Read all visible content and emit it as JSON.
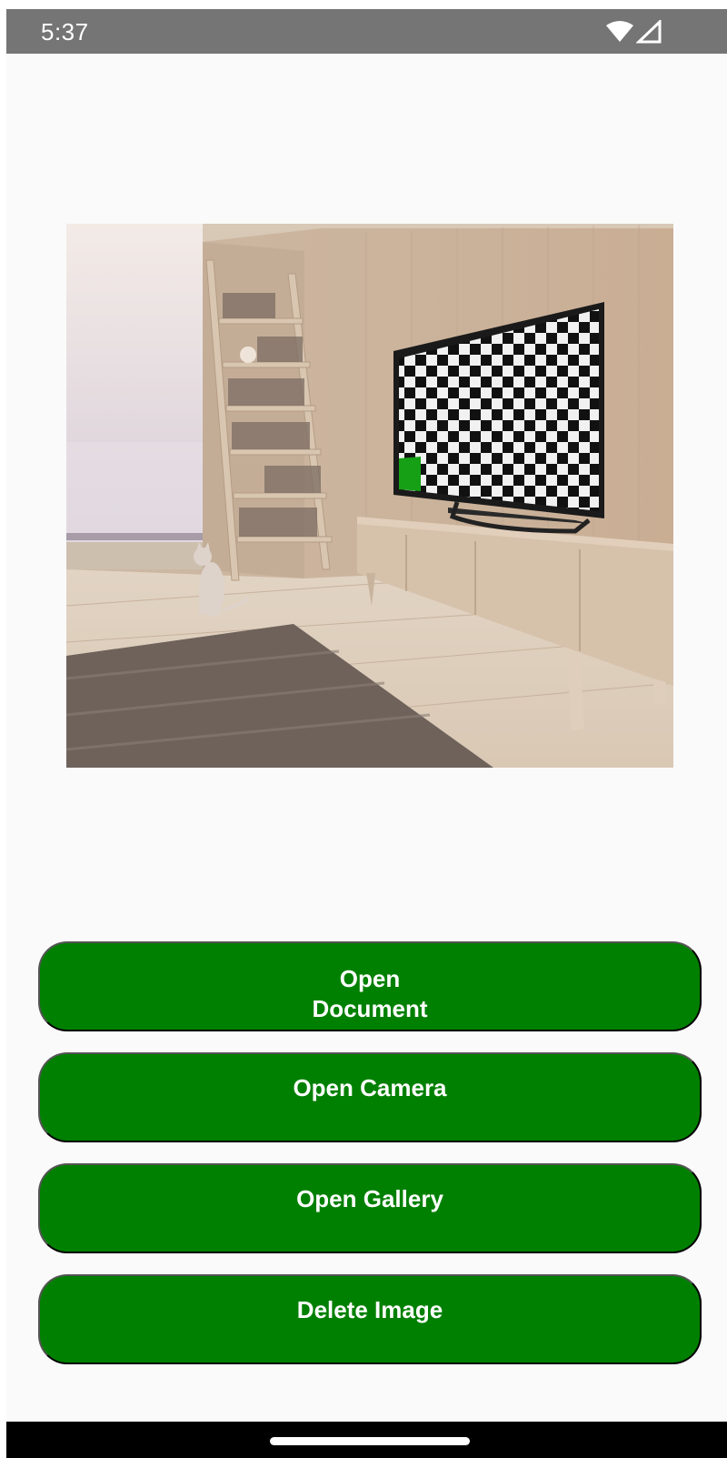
{
  "status_bar": {
    "time": "5:37",
    "icons": [
      "wifi-icon",
      "cell-signal-icon"
    ]
  },
  "preview": {
    "image_name": "room-preview-image",
    "description_icon": "living-room-photo"
  },
  "buttons": {
    "open_document": "Open\nDocument",
    "open_camera": "Open Camera",
    "open_gallery": "Open Gallery",
    "delete_image": "Delete Image"
  },
  "colors": {
    "button_background": "#008000",
    "button_text": "#ffffff",
    "status_bar": "#757575",
    "screen_background": "#fafafa",
    "nav_bar": "#000000"
  }
}
